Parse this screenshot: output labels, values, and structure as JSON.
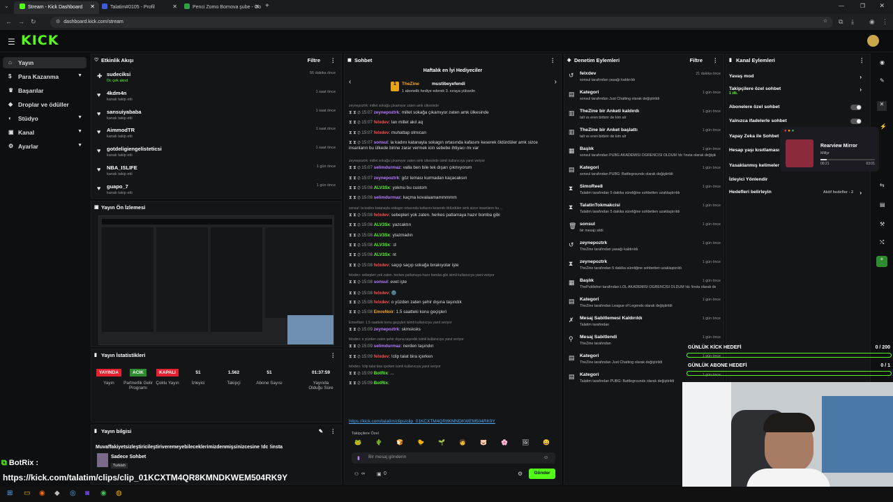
{
  "browser": {
    "tabs": [
      {
        "label": "Stream - Kick Dashboard",
        "active": true
      },
      {
        "label": "Talatim#0105 - Profil",
        "active": false
      },
      {
        "label": "Penci Zomo Bornova şube - Go",
        "active": false
      }
    ],
    "url": "dashboard.kick.com/stream",
    "new_tab": "+"
  },
  "app": {
    "logo": "KICK",
    "accent": "#53fc18"
  },
  "sidebar": {
    "items": [
      {
        "label": "Yayın",
        "icon": "home-icon",
        "active": true
      },
      {
        "label": "Para Kazanma",
        "icon": "money-icon",
        "chev": "⌄"
      },
      {
        "label": "Başarılar",
        "icon": "trophy-icon"
      },
      {
        "label": "Droplar ve ödüller",
        "icon": "gift-icon"
      },
      {
        "label": "Stüdyo",
        "icon": "studio-icon",
        "chev": "⌄"
      },
      {
        "label": "Kanal",
        "icon": "channel-icon",
        "chev": "⌄"
      },
      {
        "label": "Ayarlar",
        "icon": "gear-icon",
        "chev": "⌄"
      }
    ]
  },
  "activity": {
    "title": "Etkinlik Akışı",
    "filter": "Filtre",
    "items": [
      {
        "name": "sudeciksi",
        "sub": "Dc çek aknd",
        "time": "56 dakika önce"
      },
      {
        "name": "4kdm4n",
        "sub": "kanalı takip etti",
        "time": "1 saat önce"
      },
      {
        "name": "sansuiyababa",
        "sub": "kanalı takip etti",
        "time": "1 saat önce"
      },
      {
        "name": "AimmodTR",
        "sub": "kanalı takip etti",
        "time": "1 saat önce"
      },
      {
        "name": "gotdeligiengelisteticsi",
        "sub": "kanalı takip etti",
        "time": "1 saat önce"
      },
      {
        "name": "NBA_ISLIFE",
        "sub": "kanalı takip etti",
        "time": "1 gün önce"
      },
      {
        "name": "guapo_7",
        "sub": "kanalı takip etti",
        "time": "1 gün önce"
      }
    ]
  },
  "preview": {
    "title": "Yayın Ön İzlemesi"
  },
  "stats": {
    "title": "Yayın İstatistikleri",
    "items": [
      {
        "value": "YAYINDA",
        "label": "Yayın",
        "color": "#e5202f"
      },
      {
        "value": "ACIK",
        "label": "Partnerlik Gelir Programı",
        "color": "#2e8b2e"
      },
      {
        "value": "KAPALI",
        "label": "Çoklu Yayın",
        "color": "#e5202f"
      },
      {
        "value": "51",
        "label": "İzleyici"
      },
      {
        "value": "1.562",
        "label": "Takipçi"
      },
      {
        "value": "51",
        "label": "Abone Sayısı"
      },
      {
        "value": "01:37:59",
        "label": "Yayında Olduğu Süre"
      }
    ]
  },
  "stream_info": {
    "title": "Yayın bilgisi",
    "stream_title": "Muvaffakiyetsizleştiricileştiriveremeyebileceklerimizdenmişsinizcesine !dc !insta",
    "category": "Sadece Sohbet",
    "language": "Turkish"
  },
  "chat": {
    "title": "Sohbet",
    "leaderboard_title": "Haftalık en İyi Hediyeciler",
    "top_gifters": [
      {
        "name": "TheZine",
        "count": "1"
      },
      {
        "name": "mustibeyefendi",
        "count": "1"
      }
    ],
    "gift_note": "1 abonelik hediye ederek 3. sıraya yükselin",
    "messages": [
      {
        "reply": "zeynepoztrk: millet sokağa çıkamıyor zaten amk ülkesinde",
        "time": "",
        "user": "",
        "text": ""
      },
      {
        "time": "15:07",
        "user": "zeynepoztrk",
        "color": "#b77cff",
        "text": "millet sokağa çıkamıyor zaten amk ülkesinde"
      },
      {
        "time": "15:07",
        "user": "felxdev",
        "color": "#ff4d4d",
        "text": "lan millet akıl aq"
      },
      {
        "time": "15:07",
        "user": "felxdev",
        "color": "#ff4d4d",
        "text": "muhattap olmıcan"
      },
      {
        "time": "15:07",
        "user": "sonsul",
        "color": "#b77cff",
        "text": "la kadını katanayla sokagın ortasında kafasını keserek öldürdüler amk sizce insanların bu ülkede birine zarar vermek icin sebebe ihtiyacı mı var"
      },
      {
        "reply": "zeynepoztrk: millet sokağa çıkamıyor zaten amk ülkesinde isimli kullanıcıya yanıt veriyor"
      },
      {
        "time": "15:07",
        "user": "selimdurmaz",
        "color": "#b77cff",
        "text": "valla ben bile tek dışarı çıkmıyorum"
      },
      {
        "time": "15:07",
        "user": "zeynepoztrk",
        "color": "#b77cff",
        "text": "göz teması kurmadan kaçacaksın"
      },
      {
        "time": "15:08",
        "user": "ALV3Sx",
        "color": "#53fc18",
        "text": "yokmu bu custom"
      },
      {
        "time": "15:08",
        "user": "selimdurmaz",
        "color": "#b77cff",
        "text": "kaçma kovalaamammmmm"
      },
      {
        "reply": "sonsul: la kadını katanayla sokagın ortasında kafasını keserek öldürdüler amk sizce insanların bu ..."
      },
      {
        "time": "15:08",
        "user": "felxdev",
        "color": "#ff4d4d",
        "text": "sebepleri yok zaten. herkes patlamaya hazır bomba gibi"
      },
      {
        "time": "15:08",
        "user": "ALV3Sx",
        "color": "#53fc18",
        "text": "yazcaktın"
      },
      {
        "time": "15:08",
        "user": "ALV3Sx",
        "color": "#53fc18",
        "text": "ytazmadın"
      },
      {
        "time": "15:08",
        "user": "ALV3Sx",
        "color": "#53fc18",
        "text": ":d"
      },
      {
        "time": "15:08",
        "user": "ALV3Sx",
        "color": "#53fc18",
        "text": "nt"
      },
      {
        "time": "15:08",
        "user": "felxdev",
        "color": "#ff4d4d",
        "text": "saçıp saçıp sokağa bırakıyolar işte"
      },
      {
        "reply": "felxdev: sebepleri yok zaten. herkes patlamaya hazır bomba gibi isimli kullanıcıya yanıt veriyor"
      },
      {
        "time": "15:08",
        "user": "sonsul",
        "color": "#b77cff",
        "text": "evet işte"
      },
      {
        "time": "15:08",
        "user": "felxdev",
        "color": "#ff4d4d",
        "text": "🌚"
      },
      {
        "time": "15:08",
        "user": "felxdev",
        "color": "#ff4d4d",
        "text": "o yüzden zaten şehir dışına taşındık"
      },
      {
        "time": "15:08",
        "user": "EmreNoir",
        "color": "#f5a623",
        "text": "1.5 saatteki konu geçişleri"
      },
      {
        "reply": "EmreNoir: 1.5 saatteki konu geçişleri isimli kullanıcıya yanıt veriyor"
      },
      {
        "time": "15:09",
        "user": "zeynepoztrk",
        "color": "#b77cff",
        "text": "skmsksks"
      },
      {
        "reply": "felxdev: o yüzden zaten şehir dışına taşındık isimli kullanıcıya yanıt veriyor"
      },
      {
        "time": "15:09",
        "user": "selimdurmaz",
        "color": "#b77cff",
        "text": "nerden taşındın"
      },
      {
        "time": "15:09",
        "user": "felxdev",
        "color": "#ff4d4d",
        "text": "!clip talat bira içerken"
      },
      {
        "reply": "felxdev: !clip talat bira içerken isimli kullanıcıya yanıt veriyor"
      },
      {
        "time": "15:09",
        "user": "BotRix",
        "color": "#53fc18",
        "text": "..."
      },
      {
        "time": "15:09",
        "user": "BotRix",
        "color": "#53fc18",
        "text": ""
      }
    ],
    "link": "https://kick.com/talatim/clips/clip_01KCXTM4QR8KMNDKWEM504RK9Y",
    "emote_label": "Takipçilere Özel",
    "input_placeholder": "Bir mesaj gönderin",
    "send": "Gönder",
    "points": "0",
    "infinity": "∞"
  },
  "mod": {
    "title": "Denetim Eylemleri",
    "filter": "Filtre",
    "items": [
      {
        "icon": "undo-icon",
        "name": "felxdev",
        "sub": "sonsul tarafından yasağı kaldırıldı",
        "time": "21 dakika önce"
      },
      {
        "icon": "category-icon",
        "name": "Kategori",
        "sub": "sonsul tarafından Just Chatting olarak değiştirildi",
        "time": "1 gün önce"
      },
      {
        "icon": "poll-icon",
        "name": "TheZine bir Anketi kaldırdı",
        "sub": "talt vs eren birbirir de kim alr",
        "time": "1 gün önce"
      },
      {
        "icon": "poll-icon",
        "name": "TheZine bir Anket başlattı",
        "sub": "talt vs eren birbirir de kim alr",
        "time": "1 gün önce"
      },
      {
        "icon": "title-icon",
        "name": "Başlık",
        "sub": "sonsul tarafından PUBG AKADEMİSİ ÖĞRENCİSİ OLDUM !dc !insta olarak değiştirildi",
        "time": "1 gün önce"
      },
      {
        "icon": "category-icon",
        "name": "Kategori",
        "sub": "sonsul tarafından PUBG: Battlegrounds olarak değiştirildi",
        "time": "1 gün önce"
      },
      {
        "icon": "hourglass-icon",
        "name": "SimoRee8",
        "sub": "Talatim tarafından 5 dakika süreliğine sohbetten uzaklaştırıldı",
        "time": "1 gün önce"
      },
      {
        "icon": "hourglass-icon",
        "name": "TalatinTokmakcisi",
        "sub": "Talatim tarafından 5 dakika süreliğine sohbetten uzaklaştırıldı",
        "time": "1 gün önce"
      },
      {
        "icon": "trash-icon",
        "name": "sonsul",
        "sub": "bir mesajı sildi",
        "time": "1 gün önce"
      },
      {
        "icon": "undo-icon",
        "name": "zeynepoztrk",
        "sub": "TheZine tarafından yasağı kaldırıldı",
        "time": "1 gün önce"
      },
      {
        "icon": "hourglass-icon",
        "name": "zeynepoztrk",
        "sub": "TheZine tarafından 5 dakika süreliğine sohbetten uzaklaştırıldı",
        "time": "1 gün önce"
      },
      {
        "icon": "title-icon",
        "name": "Başlık",
        "sub": "ThePublisher tarafından LOL AKADEMİSİ ÖĞRENCİSİ OLDUM !dc !insta olarak değiştirildi",
        "time": "1 gün önce"
      },
      {
        "icon": "category-icon",
        "name": "Kategori",
        "sub": "TheZine tarafından League of Legends olarak değiştirildi",
        "time": "1 gün önce"
      },
      {
        "icon": "unpin-icon",
        "name": "Mesaj Sabitlemesi Kaldırıldı",
        "sub": "Talatim tarafından",
        "time": "1 gün önce"
      },
      {
        "icon": "pin-icon",
        "name": "Mesaj Sabitlendi",
        "sub": "TheZine tarafından",
        "time": "1 gün önce"
      },
      {
        "icon": "category-icon",
        "name": "Kategori",
        "sub": "TheZine tarafından Just Chatting olarak değiştirildi",
        "time": "1 gün önce"
      },
      {
        "icon": "category-icon",
        "name": "Kategori",
        "sub": "Talatim tarafından PUBG: Battlegrounds olarak değiştirildi",
        "time": "1 gün önce"
      }
    ]
  },
  "channel": {
    "title": "Kanal Eylemleri",
    "items": [
      {
        "label": "Yavaş mod",
        "kind": "arrow"
      },
      {
        "label": "Takipçilere özel sohbet",
        "sub": "1 dk.",
        "kind": "arrow"
      },
      {
        "label": "Abonelere özel sohbet",
        "kind": "toggle"
      },
      {
        "label": "Yalnızca ifadelerle sohbet",
        "kind": "toggle"
      },
      {
        "label": "Yapay Zeka ile Sohbet",
        "kind": ""
      },
      {
        "label": "Hesap yaşı kısıtlaması",
        "kind": ""
      },
      {
        "label": "Yasaklanmış kelimeler",
        "kind": ""
      },
      {
        "label": "İzleyici Yönlendir",
        "kind": ""
      },
      {
        "label": "Hedefleri belirleyin",
        "kind": "arrow",
        "badge": "Aktif hedefler - 2"
      }
    ]
  },
  "mirror": {
    "title": "Rearview Mirror",
    "artist": "Millyr",
    "elapsed": "00:21",
    "total": "03:01"
  },
  "goals": [
    {
      "label": "GÜNLÜK KİCK HEDEFİ",
      "value": "0 / 200",
      "progress": 0
    },
    {
      "label": "GÜNLÜK ABONE HEDEFİ",
      "value": "0 / 1",
      "progress": 0
    }
  ],
  "overlay": {
    "bot_name": "BotRix :",
    "link": "https://kick.com/talatim/clips/clip_01KCXTM4QR8KMNDKWEM504RK9Y"
  }
}
